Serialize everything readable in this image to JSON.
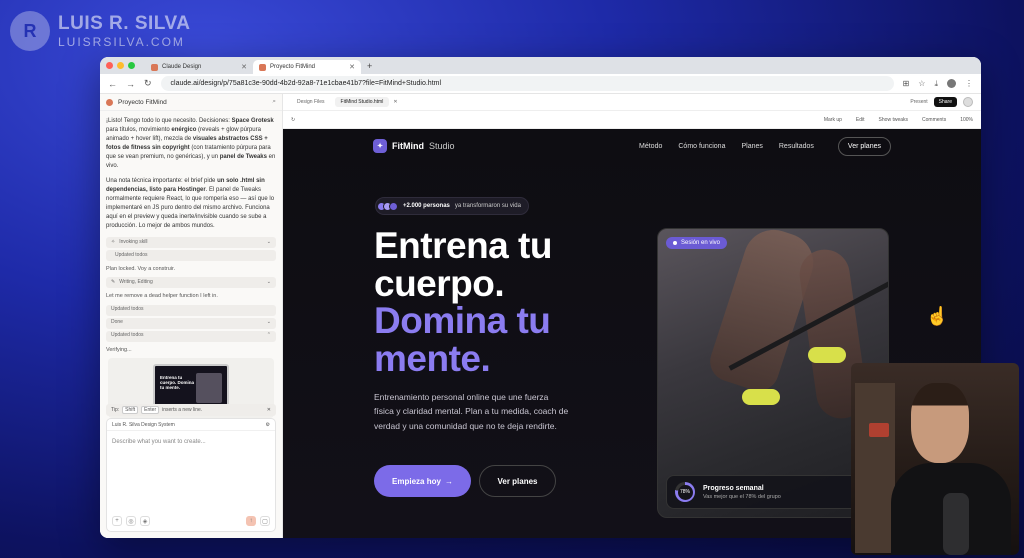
{
  "watermark": {
    "initials": "R",
    "name": "LUIS R. SILVA",
    "site": "LUISRSILVA.COM"
  },
  "browser": {
    "tabs": [
      {
        "label": "Claude Design",
        "active": false
      },
      {
        "label": "Proyecto FitMind",
        "active": true
      }
    ],
    "url": "claude.ai/design/p/75a81c3e-90dd-4b2d-92a8-71e1cbae41b7?file=FitMind+Studio.html"
  },
  "chat": {
    "title": "Proyecto FitMind",
    "message1_html": "¡Listo! Tengo todo lo que necesito. Decisiones: <b>Space Grotesk</b> para títulos, movimiento <b>enérgico</b> (reveals + glow púrpura animado + hover lift), mezcla de <b>visuales abstractos CSS + fotos de fitness sin copyright</b> (con tratamiento púrpura para que se vean premium, no genéricas), y un <b>panel de Tweaks</b> en vivo.",
    "message2_html": "Una nota técnica importante: el brief pide <b>un solo .html sin dependencias, listo para Hostinger</b>. El panel de Tweaks normalmente requiere React, lo que rompería eso — así que lo implementaré en JS puro dentro del mismo archivo. Funciona aquí en el preview y queda inerte/invisible cuando se sube a producción. Lo mejor de ambos mundos.",
    "steps": [
      "Invoking skill",
      "Updated todos"
    ],
    "note1": "Plan locked. Voy a construir.",
    "step2": "Writing, Editing",
    "note2": "Let me remove a dead helper function I left in.",
    "steps2": [
      "Updated todos",
      "Done",
      "Updated todos"
    ],
    "verifying": "Verifying...",
    "thumb_text": "Entrena tu cuerpo. Domina tu mente.",
    "tip": {
      "prefix": "Tip:",
      "key1": "Shift",
      "key2": "Enter",
      "suffix": "inserts a new line."
    },
    "composer": {
      "context": "Luis R. Silva Design System",
      "placeholder": "Describe what you want to create..."
    }
  },
  "preview": {
    "tabs": [
      "Design Files",
      "FitMind Studio.html"
    ],
    "present": "Present",
    "share": "Share",
    "avatar_initial": "J",
    "tools": {
      "markup": "Mark up",
      "edit": "Edit",
      "tweaks": "Show tweaks",
      "comments": "Comments",
      "zoom": "100%"
    }
  },
  "site": {
    "brand": "FitMind",
    "brand_sub": "Studio",
    "nav": [
      "Método",
      "Cómo funciona",
      "Planes",
      "Resultados"
    ],
    "nav_cta": "Ver planes",
    "badge_bold": "+2.000 personas",
    "badge_rest": "ya transformaron su vida",
    "headline_white_1": "Entrena tu",
    "headline_white_2": "cuerpo.",
    "headline_purple_1": "Domina tu",
    "headline_purple_2": "mente.",
    "lead": "Entrenamiento personal online que une fuerza física y claridad mental. Plan a tu medida, coach de verdad y una comunidad que no te deja rendirte.",
    "cta_primary": "Empieza hoy",
    "cta_primary_arrow": "→",
    "cta_secondary": "Ver planes",
    "live_label": "Sesión en vivo",
    "progress": {
      "value": "78%",
      "fraction": 0.78,
      "title": "Progreso semanal",
      "subtitle": "Vas mejor que el 78% del grupo"
    },
    "accent": "#7c6be8"
  }
}
